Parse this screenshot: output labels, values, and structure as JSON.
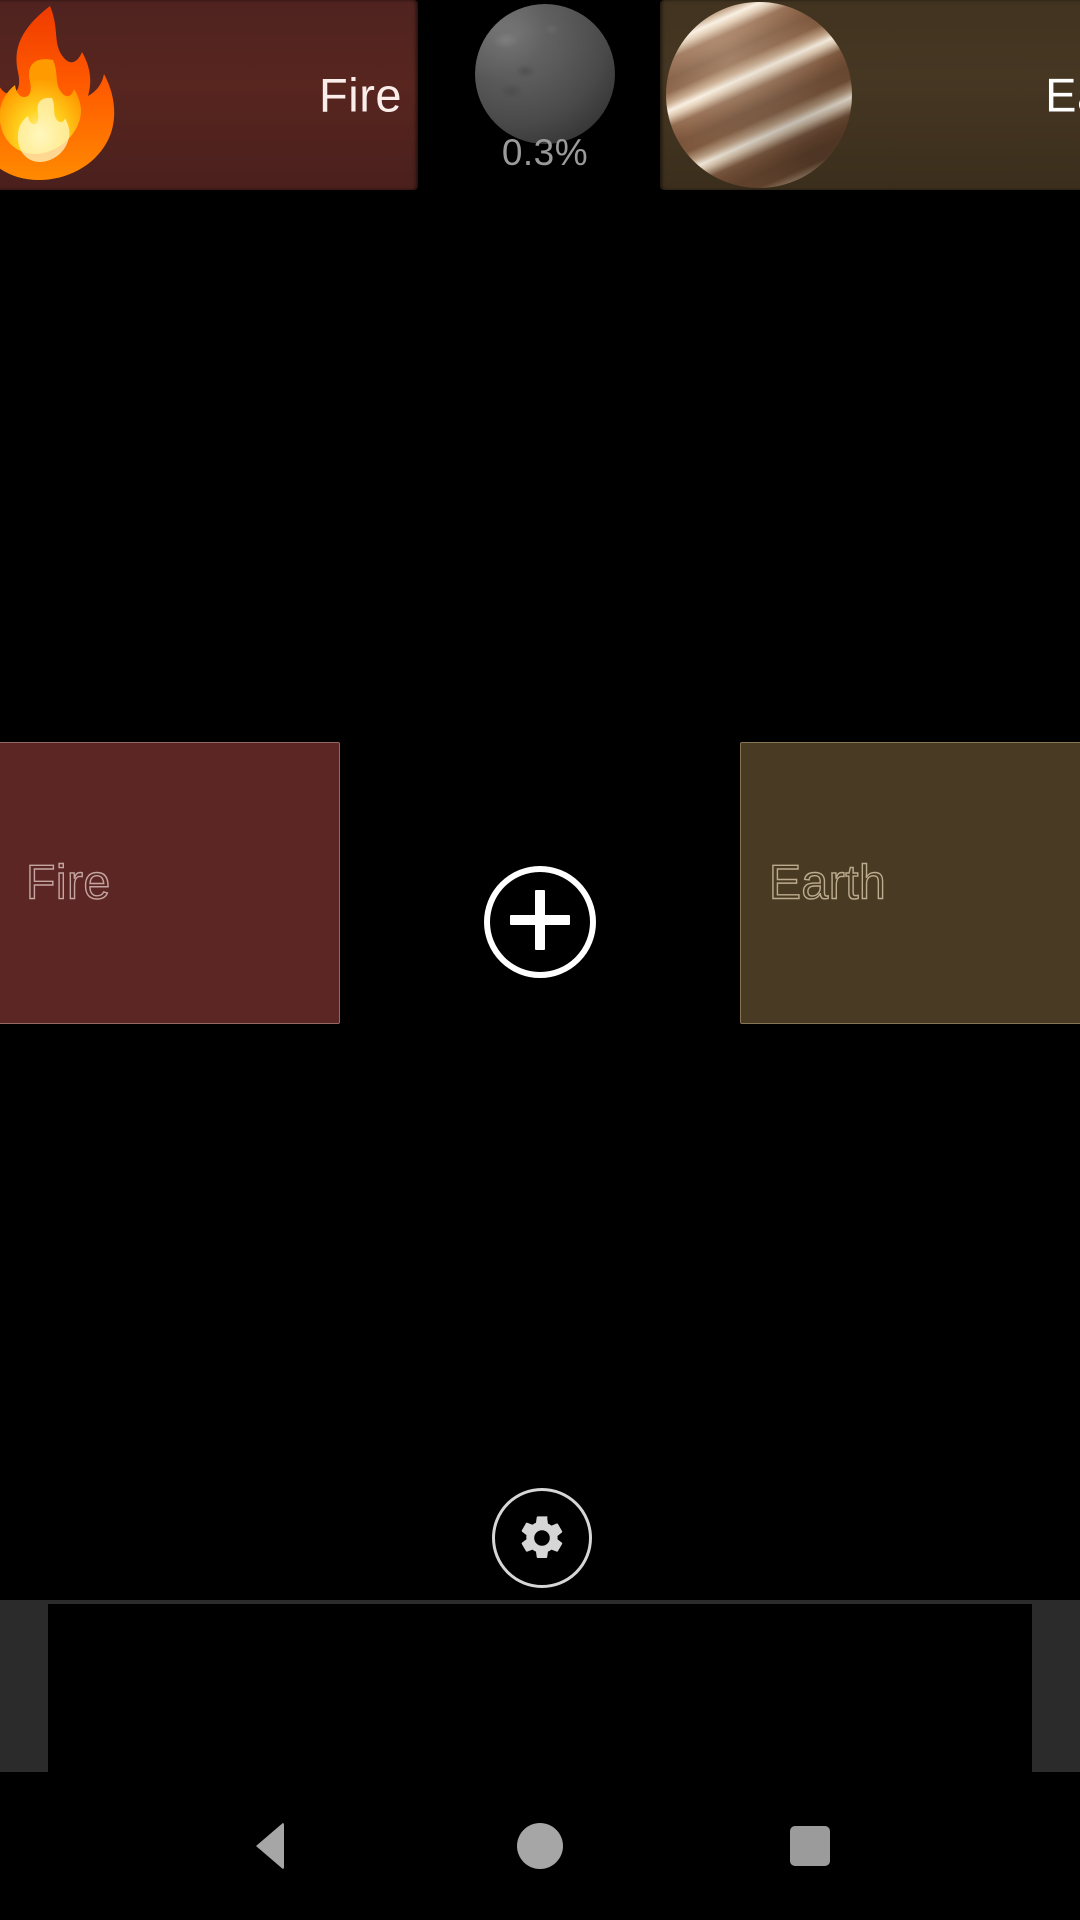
{
  "app": {
    "background_color": "#000000"
  },
  "top_bar": {
    "cards": [
      {
        "id": "fire",
        "label": "Fire",
        "icon": "fire-emoji",
        "background_color": "#4f2320",
        "label_color": "#fbeeea"
      },
      {
        "id": "earth",
        "label": "Earth",
        "icon": "dune-planet-thumbnail",
        "background_color": "#41331f",
        "label_color": "#ffffff"
      }
    ],
    "progress_orb": {
      "icon": "grey-sphere",
      "percent_label": "0.3%",
      "percent_value": 0.3,
      "percent_color": "#9a9a9a"
    }
  },
  "workspace": {
    "slots": [
      {
        "id": "fire",
        "label": "Fire",
        "background_color": "#5b2623",
        "border_color": "#c4a096"
      },
      {
        "id": "earth",
        "label": "Earth",
        "background_color": "#493a23",
        "border_color": "#baa47f"
      }
    ],
    "combine_button": {
      "icon": "plus-icon",
      "label": "",
      "color": "#ffffff"
    }
  },
  "footer": {
    "settings_button": {
      "icon": "gear-icon",
      "label": "",
      "color": "#d6d6d6"
    },
    "ad_band": {
      "label": "",
      "background_color": "#2b2b2b"
    }
  },
  "navigation_bar": {
    "buttons": [
      {
        "id": "back",
        "icon": "back-triangle-icon",
        "label": ""
      },
      {
        "id": "home",
        "icon": "home-circle-icon",
        "label": ""
      },
      {
        "id": "recents",
        "icon": "recents-square-icon",
        "label": ""
      }
    ]
  }
}
